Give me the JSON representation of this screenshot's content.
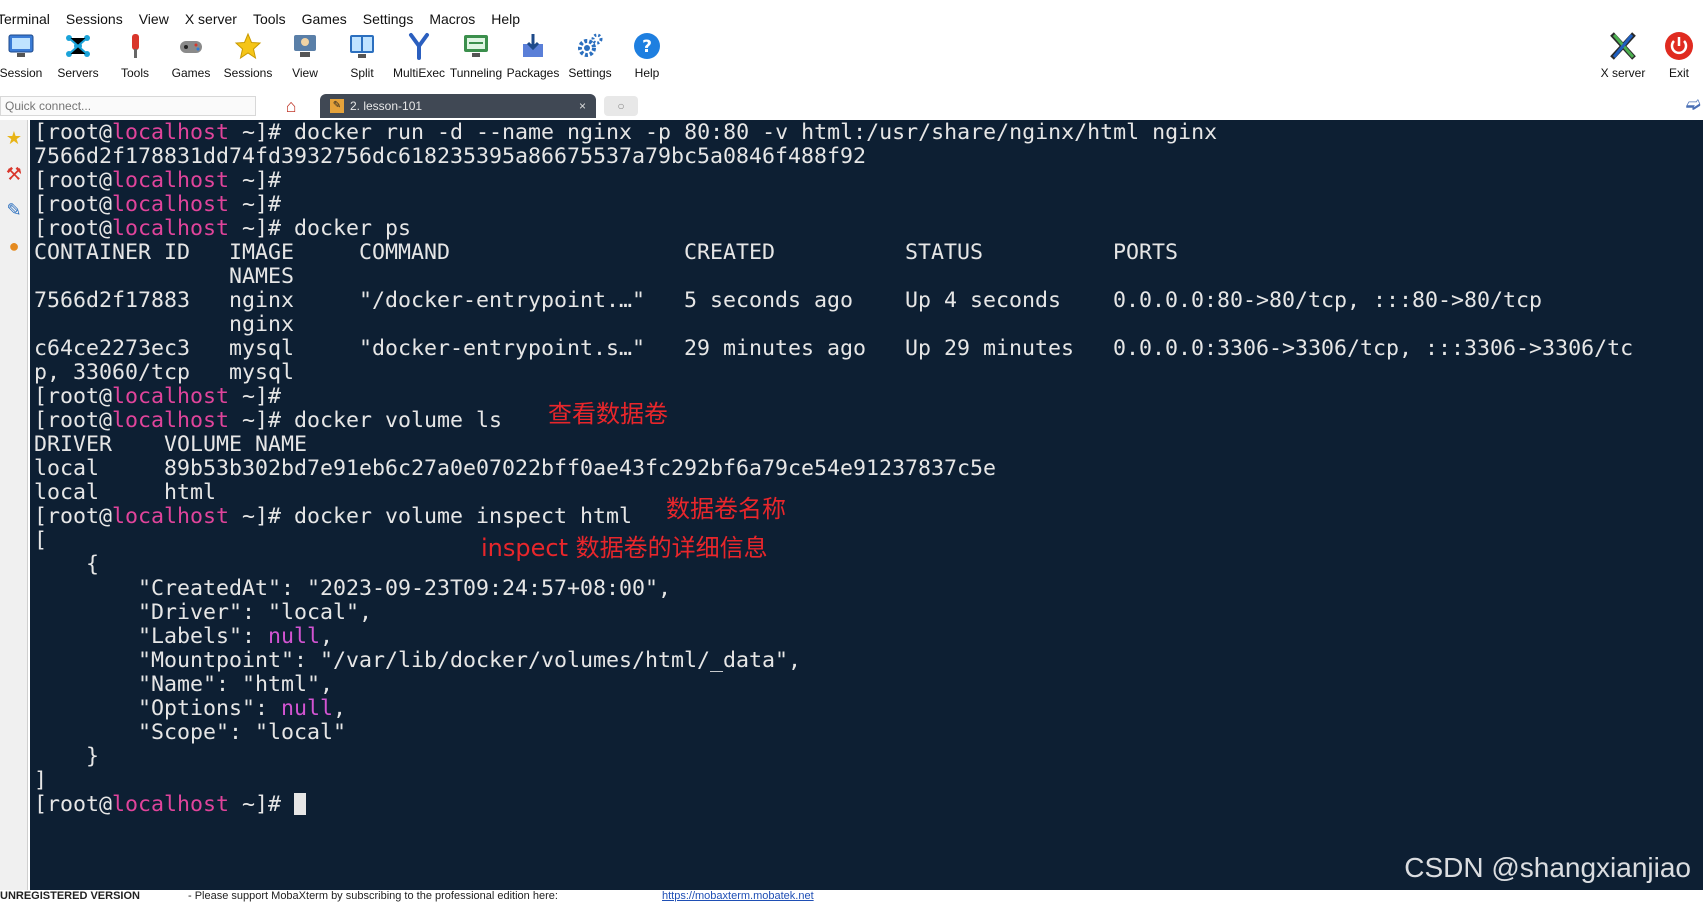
{
  "menu": [
    "Terminal",
    "Sessions",
    "View",
    "X server",
    "Tools",
    "Games",
    "Settings",
    "Macros",
    "Help"
  ],
  "toolbar": {
    "session": {
      "label": "Session",
      "icon": "session-monitor-icon"
    },
    "servers": {
      "label": "Servers",
      "icon": "servers-icon"
    },
    "tools": {
      "label": "Tools",
      "icon": "tools-icon"
    },
    "games": {
      "label": "Games",
      "icon": "games-icon"
    },
    "sessions": {
      "label": "Sessions",
      "icon": "star-icon"
    },
    "view": {
      "label": "View",
      "icon": "view-icon"
    },
    "split": {
      "label": "Split",
      "icon": "split-icon"
    },
    "multiexec": {
      "label": "MultiExec",
      "icon": "multiexec-icon"
    },
    "tunneling": {
      "label": "Tunneling",
      "icon": "tunneling-icon"
    },
    "packages": {
      "label": "Packages",
      "icon": "packages-icon"
    },
    "settings": {
      "label": "Settings",
      "icon": "gear-icon"
    },
    "help": {
      "label": "Help",
      "icon": "help-icon"
    },
    "xserver": {
      "label": "X server",
      "icon": "x-server-icon"
    },
    "exit": {
      "label": "Exit",
      "icon": "power-icon"
    }
  },
  "tabs": {
    "quick_connect_placeholder": "Quick connect...",
    "active_tab_label": "2. lesson-101",
    "close_glyph": "×"
  },
  "terminal": {
    "prompt_user": "[root@",
    "prompt_host": "localhost",
    "prompt_tail": " ~]# ",
    "lines": {
      "l1_cmd": "docker run -d --name nginx -p 80:80 -v html:/usr/share/nginx/html nginx",
      "l2": "7566d2f178831dd74fd3932756dc618235395a86675537a79bc5a0846f488f92",
      "l5_cmd": "docker ps",
      "l6": "CONTAINER ID   IMAGE     COMMAND                  CREATED          STATUS          PORTS",
      "l7": "               NAMES",
      "l8": "7566d2f17883   nginx     \"/docker-entrypoint.…\"   5 seconds ago    Up 4 seconds    0.0.0.0:80->80/tcp, :::80->80/tcp",
      "l9": "               nginx",
      "l10": "c64ce2273ec3   mysql     \"docker-entrypoint.s…\"   29 minutes ago   Up 29 minutes   0.0.0.0:3306->3306/tcp, :::3306->3306/tc",
      "l11": "p, 33060/tcp   mysql",
      "l13_cmd": "docker volume ls",
      "l14": "DRIVER    VOLUME NAME",
      "l15": "local     89b53b302bd7e91eb6c27a0e07022bff0ae43fc292bf6a79ce54e91237837c5e",
      "l16": "local     html",
      "l17_cmd": "docker volume inspect html",
      "l18": "[",
      "l19": "    {",
      "l20": "        \"CreatedAt\": \"2023-09-23T09:24:57+08:00\",",
      "l21": "        \"Driver\": \"local\",",
      "l22_a": "        \"Labels\": ",
      "l22_null": "null",
      "l22_b": ",",
      "l23": "        \"Mountpoint\": \"/var/lib/docker/volumes/html/_data\",",
      "l24": "        \"Name\": \"html\",",
      "l25_a": "        \"Options\": ",
      "l25_null": "null",
      "l25_b": ",",
      "l26": "        \"Scope\": \"local\"",
      "l27": "    }",
      "l28": "]"
    },
    "annotations": {
      "view_volumes": "查看数据卷",
      "volume_name": "数据卷名称",
      "inspect_detail": "inspect 数据卷的详细信息"
    },
    "colors": {
      "background": "#0d1f33",
      "host": "#e0449b",
      "null": "#d254d2",
      "annotation": "#e8262b"
    }
  },
  "status": {
    "unregistered": "UNREGISTERED VERSION",
    "support": "-  Please support MobaXterm by subscribing to the professional edition here:",
    "link": "https://mobaxterm.mobatek.net"
  },
  "watermark": "CSDN @shangxianjiao"
}
